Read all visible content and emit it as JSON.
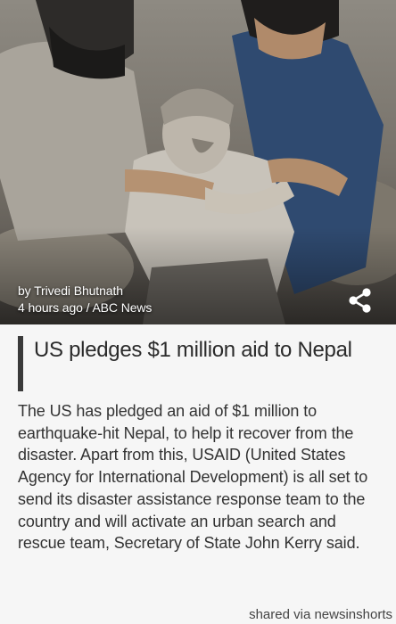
{
  "article": {
    "author": "by Trivedi Bhutnath",
    "meta": "4 hours ago / ABC News",
    "title": "US pledges $1 million aid to Nepal",
    "body": "The US has pledged an aid of $1 million to earthquake-hit Nepal, to help it recover from the disaster. Apart from this, USAID (United States Agency for International Development) is all set to send its disaster assistance response team to the country and will activate an urban search and rescue team, Secretary of State John Kerry said."
  },
  "share": {
    "icon": "share-icon"
  },
  "footer": {
    "text": "shared via newsinshorts"
  },
  "colors": {
    "background": "#f6f6f6",
    "title_accent": "#3a3a3a",
    "text": "#333333"
  }
}
